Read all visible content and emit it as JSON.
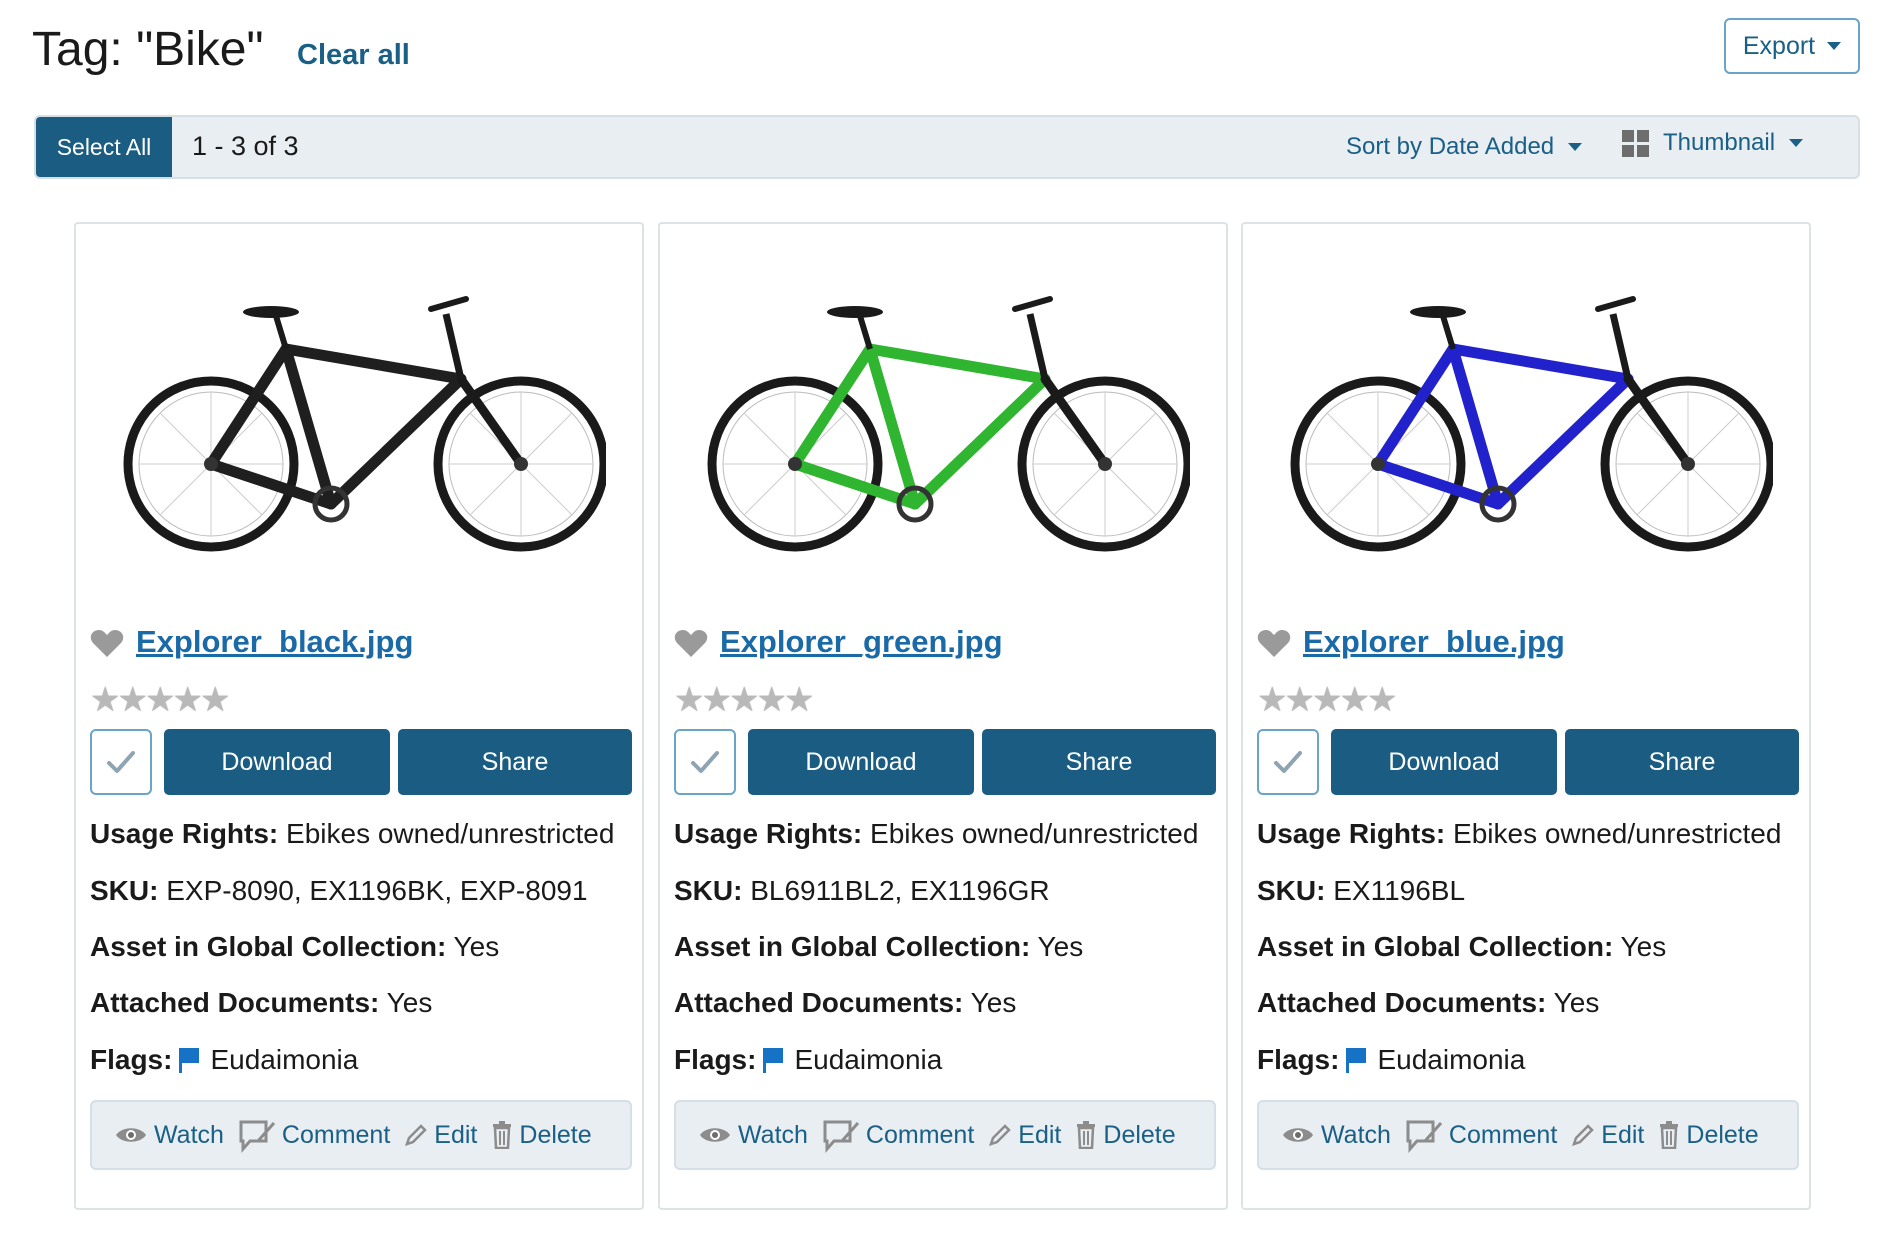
{
  "header": {
    "title": "Tag: \"Bike\"",
    "clear_all": "Clear all",
    "export_label": "Export"
  },
  "toolbar": {
    "select_all": "Select All",
    "count": "1 - 3 of 3",
    "sort_label": "Sort by Date Added",
    "view_label": "Thumbnail"
  },
  "cards": [
    {
      "file_name": "Explorer_black.jpg",
      "frame_color": "#1f1f1f",
      "rating": 0,
      "download_label": "Download",
      "share_label": "Share",
      "usage_label": "Usage Rights:",
      "usage_value": "Ebikes owned/unrestricted",
      "sku_label": "SKU:",
      "sku_value": "EXP-8090, EX1196BK, EXP-8091",
      "global_label": "Asset in Global Collection:",
      "global_value": "Yes",
      "attached_label": "Attached Documents:",
      "attached_value": "Yes",
      "flags_label": "Flags:",
      "flags_value": "Eudaimonia",
      "watch": "Watch",
      "comment": "Comment",
      "edit": "Edit",
      "delete": "Delete"
    },
    {
      "file_name": "Explorer_green.jpg",
      "frame_color": "#2fb52f",
      "rating": 0,
      "download_label": "Download",
      "share_label": "Share",
      "usage_label": "Usage Rights:",
      "usage_value": "Ebikes owned/unrestricted",
      "sku_label": "SKU:",
      "sku_value": "BL6911BL2, EX1196GR",
      "global_label": "Asset in Global Collection:",
      "global_value": "Yes",
      "attached_label": "Attached Documents:",
      "attached_value": "Yes",
      "flags_label": "Flags:",
      "flags_value": "Eudaimonia",
      "watch": "Watch",
      "comment": "Comment",
      "edit": "Edit",
      "delete": "Delete"
    },
    {
      "file_name": "Explorer_blue.jpg",
      "frame_color": "#2222cc",
      "rating": 0,
      "download_label": "Download",
      "share_label": "Share",
      "usage_label": "Usage Rights:",
      "usage_value": "Ebikes owned/unrestricted",
      "sku_label": "SKU:",
      "sku_value": "EX1196BL",
      "global_label": "Asset in Global Collection:",
      "global_value": "Yes",
      "attached_label": "Attached Documents:",
      "attached_value": "Yes",
      "flags_label": "Flags:",
      "flags_value": "Eudaimonia",
      "watch": "Watch",
      "comment": "Comment",
      "edit": "Edit",
      "delete": "Delete"
    }
  ],
  "colors": {
    "accent": "#1b5d82",
    "link": "#1a6aa8",
    "flag": "#1672c4",
    "toolbar_bg": "#e8eef2"
  },
  "icons": {
    "favorite": "heart-icon",
    "check": "check-icon",
    "flag": "flag-icon",
    "watch": "eye-icon",
    "comment": "comment-icon",
    "edit": "pencil-icon",
    "delete": "trash-icon",
    "view": "grid-icon"
  }
}
